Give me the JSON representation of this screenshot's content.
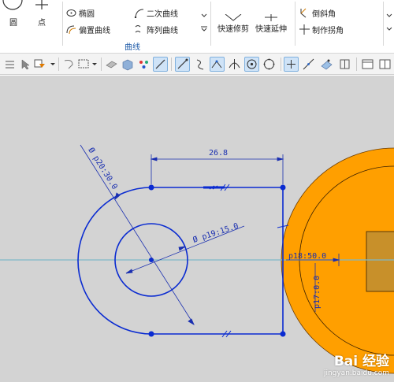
{
  "ribbon": {
    "circle_label": "圆",
    "point_label": "点",
    "ellipse_label": "椭圆",
    "offset_curve_label": "偏置曲线",
    "conic_label": "二次曲线",
    "pattern_curve_label": "阵列曲线",
    "quick_trim_label": "快速修剪",
    "quick_extend_label": "快速延伸",
    "chamfer_label": "倒斜角",
    "corner_label": "制作拐角",
    "group_label": "曲线"
  },
  "sketch": {
    "dim_length": "26.8",
    "dim_outer_diameter": "Ø p20:30.0",
    "dim_inner_diameter": "Ø p19:15.0",
    "dim_p18": "p18:50.0",
    "dim_p17": "p17:0.0"
  },
  "colors": {
    "sketch_line": "#0a2bd1",
    "solid_fill": "#ff9f00",
    "canvas_bg": "#d3d3d3",
    "accent": "#1e5aa8"
  },
  "watermark": {
    "brand": "Bai 经验",
    "url": "jingyan.baidu.com"
  }
}
